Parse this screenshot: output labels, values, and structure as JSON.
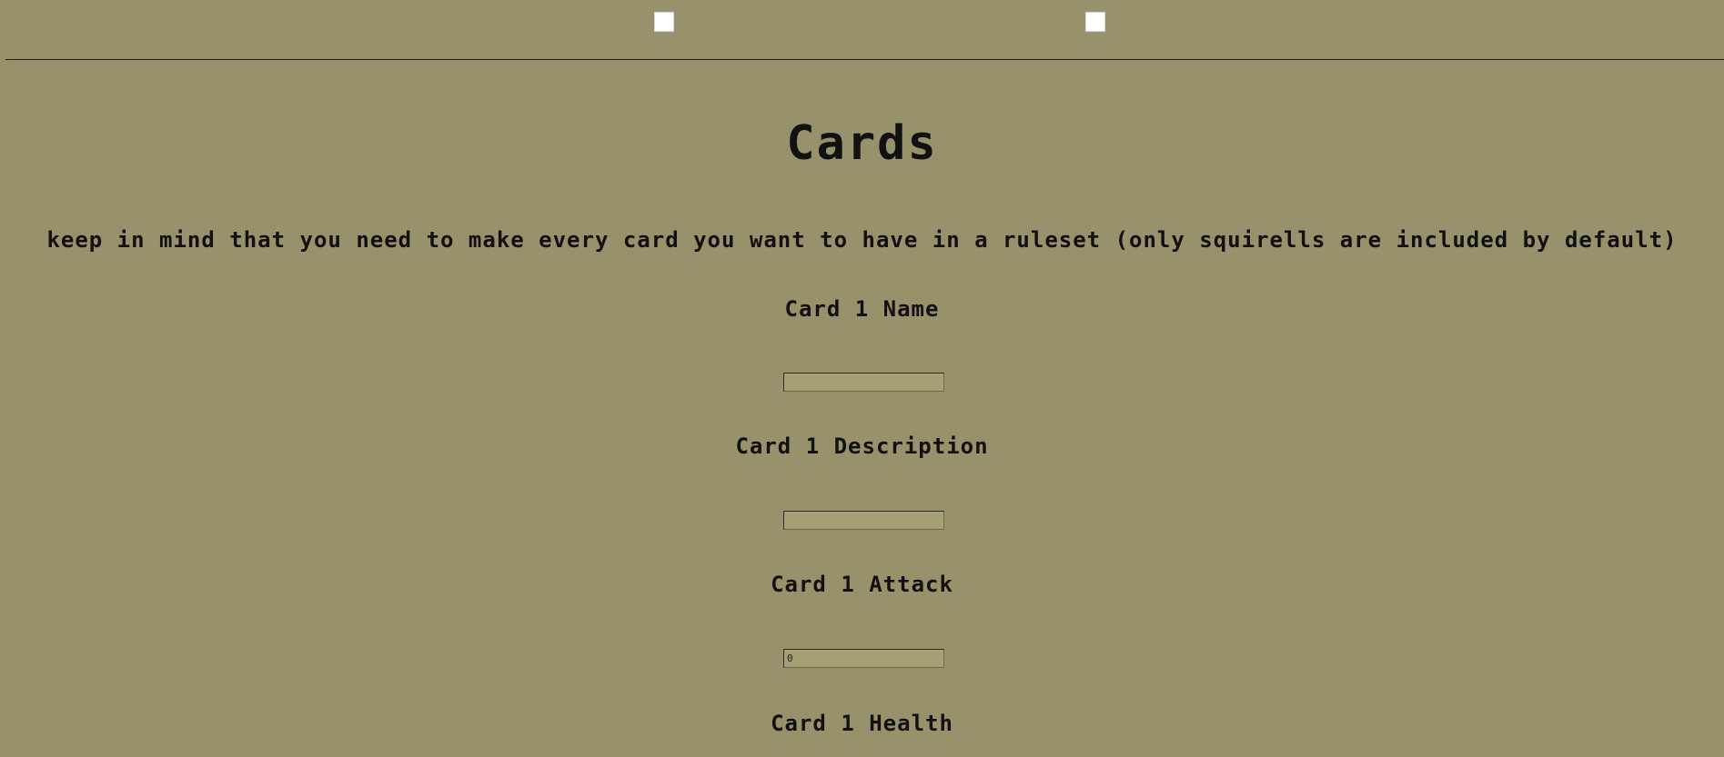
{
  "header": {
    "checkbox_1_checked": false,
    "checkbox_2_checked": false
  },
  "main": {
    "title": "Cards",
    "note": "keep in mind that you need to make every card you want to have in a ruleset (only squirells are included by default)",
    "fields": {
      "name_label": "Card 1 Name",
      "name_value": "",
      "description_label": "Card 1 Description",
      "description_value": "",
      "attack_label": "Card 1 Attack",
      "attack_value": "0",
      "health_label": "Card 1 Health"
    }
  },
  "colors": {
    "background": "#97916c",
    "input_background": "#a59f75",
    "text": "#111111"
  }
}
